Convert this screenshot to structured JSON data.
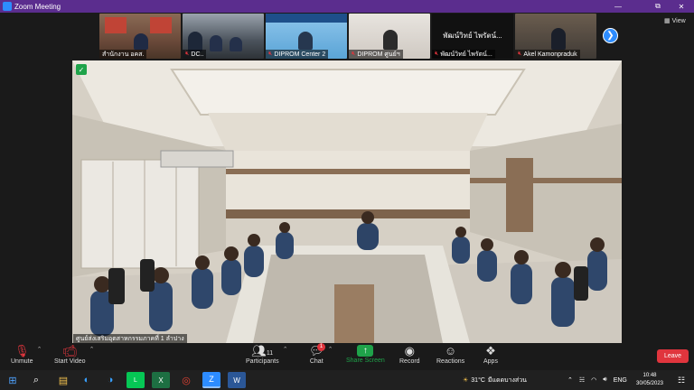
{
  "window": {
    "title": "Zoom Meeting",
    "minimize": "—",
    "maximize": "⧉",
    "close": "✕"
  },
  "view_button": {
    "label": "View",
    "icon": "grid-icon"
  },
  "thumbnails": [
    {
      "name": "สำนักงาน อคส.",
      "muted": false,
      "bg": "#6b4a3a"
    },
    {
      "name": "DC..",
      "muted": true,
      "bg": "#3f4650"
    },
    {
      "name": "DIPROM Center 2",
      "muted": true,
      "bg": "#5aa4d6"
    },
    {
      "name": "DIPROM ศูนย์ฯ",
      "muted": true,
      "bg": "#d9d4cf"
    },
    {
      "name": "พัฒน์วิทย์ ไพรัตน์...",
      "muted": true,
      "bg": "#111111"
    },
    {
      "name": "Akel Kamonpraduk",
      "muted": true,
      "bg": "#4d4a45"
    }
  ],
  "thumb_caption_4": "พัฒน์วิทย์ ไพรัตน์...",
  "main_video": {
    "name": "ศูนย์ส่งเสริมอุตสาหกรรมภาคที่ 1 ลำปาง",
    "muted": false
  },
  "toolbar": {
    "unmute": "Unmute",
    "start_video": "Start Video",
    "participants": "Participants",
    "participants_count": "11",
    "chat": "Chat",
    "chat_badge": "1",
    "share_screen": "Share Screen",
    "record": "Record",
    "reactions": "Reactions",
    "apps": "Apps",
    "leave": "Leave"
  },
  "taskbar": {
    "weather": "31°C",
    "weather_text": "มีแดดบางส่วน",
    "lang": "ENG",
    "time": "10:48",
    "date": "30/05/2023"
  },
  "colors": {
    "titlebar": "#5b2d8e",
    "accent": "#2d8cff",
    "leave": "#e0353d",
    "share": "#1fa34a"
  }
}
